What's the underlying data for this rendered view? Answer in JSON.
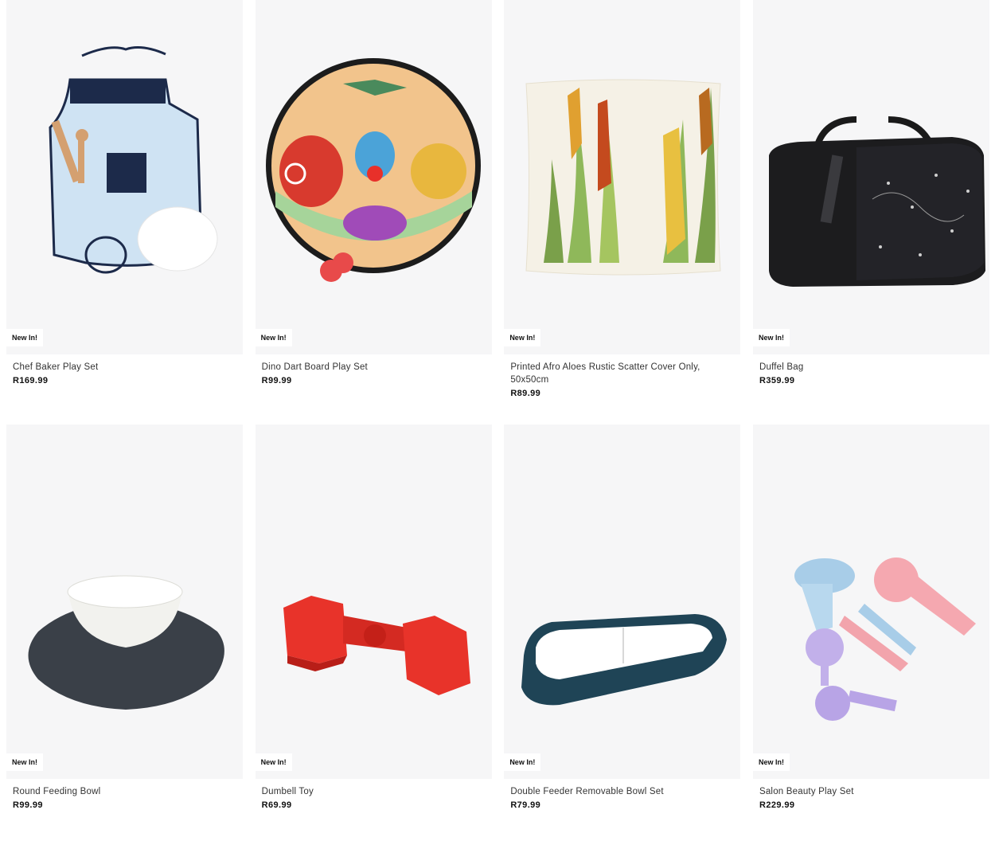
{
  "products": [
    {
      "title": "Chef Baker Play Set",
      "price": "R169.99",
      "badge": "New In!",
      "icon": "apron-icon"
    },
    {
      "title": "Dino Dart Board Play Set",
      "price": "R99.99",
      "badge": "New In!",
      "icon": "dartboard-icon"
    },
    {
      "title": "Printed Afro Aloes Rustic Scatter Cover Only, 50x50cm",
      "price": "R89.99",
      "badge": "New In!",
      "icon": "cushion-icon"
    },
    {
      "title": "Duffel Bag",
      "price": "R359.99",
      "badge": "New In!",
      "icon": "duffel-bag-icon"
    },
    {
      "title": "Round Feeding Bowl",
      "price": "R99.99",
      "badge": "New In!",
      "icon": "bowl-icon"
    },
    {
      "title": "Dumbell Toy",
      "price": "R69.99",
      "badge": "New In!",
      "icon": "dumbbell-icon"
    },
    {
      "title": "Double Feeder Removable Bowl Set",
      "price": "R79.99",
      "badge": "New In!",
      "icon": "double-feeder-icon"
    },
    {
      "title": "Salon Beauty Play Set",
      "price": "R229.99",
      "badge": "New In!",
      "icon": "salon-set-icon"
    }
  ],
  "colors": {
    "image_bg": "#f6f6f7",
    "badge_bg": "#ffffff",
    "price_text": "#111111"
  }
}
